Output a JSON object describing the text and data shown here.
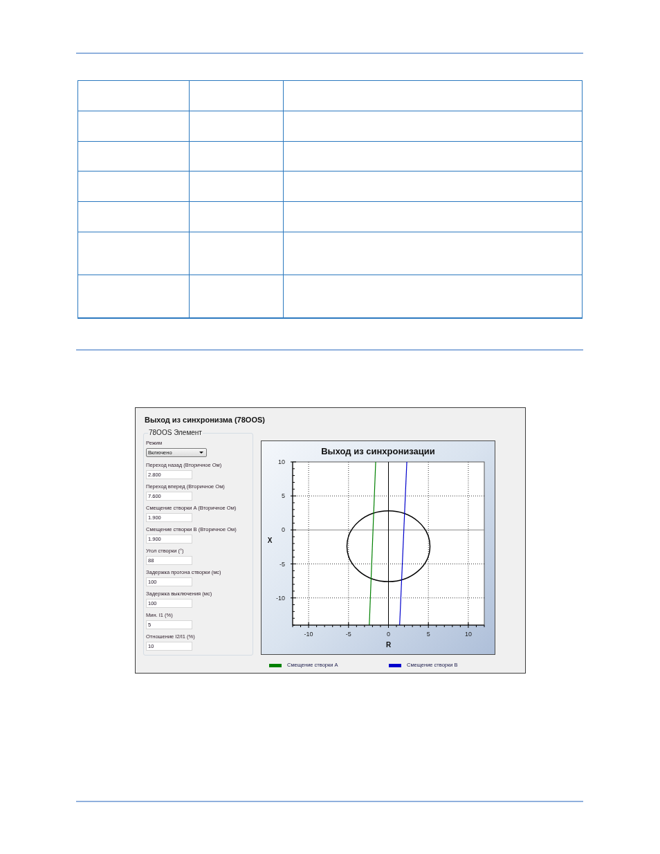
{
  "dialog": {
    "title": "Выход из синхронизма (78OOS)",
    "group": {
      "title": "78OOS Элемент",
      "fields": [
        {
          "kind": "dropdown",
          "label": "Режим",
          "value": "Включено"
        },
        {
          "kind": "text",
          "label": "Переход назад (Вторичное Ом)",
          "value": "2.800"
        },
        {
          "kind": "text",
          "label": "Переход вперед (Вторичное Ом)",
          "value": "7.600"
        },
        {
          "kind": "text",
          "label": "Смещение створки A (Вторичное Ом)",
          "value": "1.900"
        },
        {
          "kind": "text",
          "label": "Смещение створки B (Вторичное Ом)",
          "value": "1.900"
        },
        {
          "kind": "text",
          "label": "Угол створки (°)",
          "value": "88"
        },
        {
          "kind": "text",
          "label": "Задержка прогона створки (мс)",
          "value": "100"
        },
        {
          "kind": "text",
          "label": "Задержка выключения (мс)",
          "value": "100"
        },
        {
          "kind": "text",
          "label": "Мин. I1 (%)",
          "value": "5"
        },
        {
          "kind": "text",
          "label": "Отношение I2/I1 (%)",
          "value": "10"
        }
      ]
    },
    "chart": {
      "chart_data": {
        "type": "line",
        "title": "Выход из синхронизации",
        "xlabel": "R",
        "ylabel": "X",
        "xlim": [
          -12,
          12
        ],
        "ylim": [
          -14,
          10
        ],
        "xticks": [
          {
            "value": -10,
            "label": "-10"
          },
          {
            "value": -5,
            "label": "-5"
          },
          {
            "value": 0,
            "label": "0"
          },
          {
            "value": 5,
            "label": "5"
          },
          {
            "value": 10,
            "label": "10"
          }
        ],
        "yticks": [
          {
            "value": -10,
            "label": "-10"
          },
          {
            "value": -5,
            "label": "-5"
          },
          {
            "value": 0,
            "label": "0"
          },
          {
            "value": 5,
            "label": "5"
          },
          {
            "value": 10,
            "label": "10"
          }
        ],
        "grid": true,
        "legend": "bottom",
        "series": [
          {
            "name": "Смещение створки A",
            "color": "#008000",
            "x": [
              -2.4,
              -1.6
            ],
            "values": [
              -14,
              10
            ]
          },
          {
            "name": "Смещение створки B",
            "color": "#0000cc",
            "x": [
              1.4,
              2.3
            ],
            "values": [
              -14,
              10
            ]
          }
        ]
      }
    }
  }
}
